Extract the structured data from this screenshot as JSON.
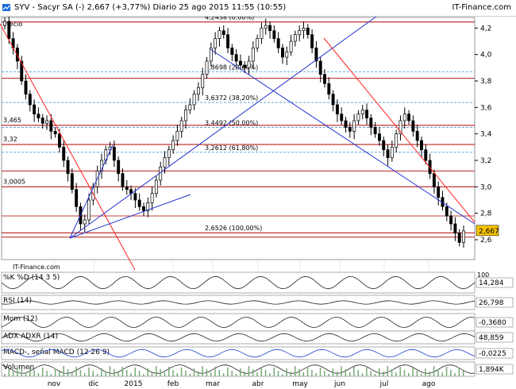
{
  "header": {
    "symbol_line": "SYV - Sacyr SA (-)   2,667 (+3,77%)   Diario  25 ago 2015 11:55 (10:55)",
    "brand": "IT-Finance.com"
  },
  "colors": {
    "fib_line": "#b00000",
    "trend_blue": "#2233cc",
    "trend_red": "#ff2222",
    "candle_up": "#ffffff",
    "candle_down": "#000000",
    "last_price_bg": "#f7c400"
  },
  "chart_data": [
    {
      "type": "candlestick",
      "title": "Precio",
      "watermark": "IT-Finance.com",
      "x_ticks": [
        "nov",
        "dic",
        "2015",
        "feb",
        "mar",
        "abr",
        "may",
        "jun",
        "jul",
        "ago"
      ],
      "y_ticks": [
        2.6,
        2.8,
        3.0,
        3.2,
        3.4,
        3.6,
        3.8,
        4.0,
        4.2
      ],
      "ylim": [
        2.45,
        4.28
      ],
      "last_price": "2,667",
      "left_levels": [
        {
          "label": "3,465",
          "value": 3.465
        },
        {
          "label": "3,32",
          "value": 3.32
        },
        {
          "label": "3,0005",
          "value": 3.0005
        }
      ],
      "fib_levels": [
        {
          "label": "4,2458 (0,00%)",
          "value": 4.2458
        },
        {
          "label": "3,8698 (23,60%)",
          "value": 3.8698
        },
        {
          "label": "3,6372 (38,20%)",
          "value": 3.6372
        },
        {
          "label": "3,4492 (50,00%)",
          "value": 3.4492
        },
        {
          "label": "3,2612 (61,80%)",
          "value": 3.2612
        },
        {
          "label": "2,6526 (100,00%)",
          "value": 2.6526
        }
      ],
      "close_series": [
        4.25,
        4.12,
        4.05,
        3.95,
        3.8,
        3.7,
        3.62,
        3.55,
        3.52,
        3.48,
        3.5,
        3.42,
        3.4,
        3.3,
        3.2,
        3.1,
        2.98,
        2.85,
        2.72,
        2.75,
        2.9,
        3.0,
        3.12,
        3.2,
        3.28,
        3.3,
        3.2,
        3.1,
        3.0,
        2.98,
        2.95,
        2.9,
        2.85,
        2.82,
        2.88,
        2.95,
        3.05,
        3.15,
        3.22,
        3.28,
        3.35,
        3.42,
        3.5,
        3.58,
        3.62,
        3.7,
        3.75,
        3.85,
        3.95,
        4.05,
        4.12,
        4.18,
        4.15,
        4.05,
        4.0,
        3.95,
        3.92,
        3.9,
        3.95,
        4.05,
        4.12,
        4.2,
        4.22,
        4.18,
        4.12,
        4.05,
        3.98,
        4.02,
        4.1,
        4.15,
        4.18,
        4.2,
        4.15,
        4.05,
        3.95,
        3.85,
        3.78,
        3.7,
        3.62,
        3.55,
        3.5,
        3.45,
        3.42,
        3.5,
        3.55,
        3.58,
        3.52,
        3.45,
        3.4,
        3.35,
        3.28,
        3.22,
        3.3,
        3.4,
        3.5,
        3.55,
        3.5,
        3.42,
        3.35,
        3.28,
        3.2,
        3.1,
        3.0,
        2.92,
        2.85,
        2.78,
        2.72,
        2.65,
        2.58,
        2.667
      ],
      "panels": [
        {
          "name": "%K",
          "legend": "%D (14 3 5)",
          "value": "14,284",
          "scale_top": "100",
          "scale_bottom": "0"
        },
        {
          "name": "RSI (14)",
          "value": "26,798"
        },
        {
          "name": "Mom (12)",
          "value": "-0,3680"
        },
        {
          "name": "ADX",
          "legend": "ADXR (14)",
          "value": "48,859"
        },
        {
          "name": "MACD-, señal",
          "legend": "MACD (12 26 9)",
          "value": "-0,0225"
        },
        {
          "name": "Volumen",
          "value": "1,894K"
        }
      ]
    }
  ]
}
